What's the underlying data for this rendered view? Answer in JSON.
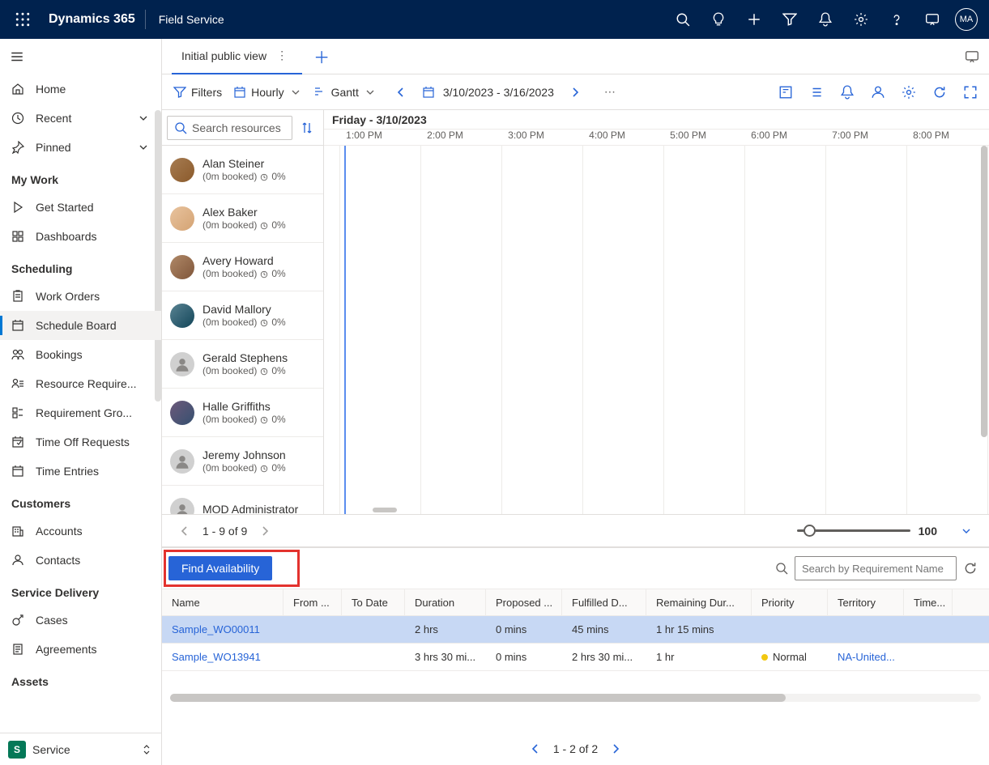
{
  "topbar": {
    "brand": "Dynamics 365",
    "app": "Field Service",
    "avatar": "MA"
  },
  "sidebar": {
    "items": {
      "home": "Home",
      "recent": "Recent",
      "pinned": "Pinned"
    },
    "groups": {
      "mywork": "My Work",
      "scheduling": "Scheduling",
      "customers": "Customers",
      "service_delivery": "Service Delivery",
      "assets": "Assets"
    },
    "mywork": {
      "get_started": "Get Started",
      "dashboards": "Dashboards"
    },
    "scheduling": {
      "work_orders": "Work Orders",
      "schedule_board": "Schedule Board",
      "bookings": "Bookings",
      "resource_req": "Resource Require...",
      "req_groups": "Requirement Gro...",
      "time_off": "Time Off Requests",
      "time_entries": "Time Entries"
    },
    "customers": {
      "accounts": "Accounts",
      "contacts": "Contacts"
    },
    "service_delivery": {
      "cases": "Cases",
      "agreements": "Agreements"
    },
    "area": "Service"
  },
  "tabs": {
    "active": "Initial public view"
  },
  "toolbar": {
    "filters": "Filters",
    "hourly": "Hourly",
    "gantt": "Gantt",
    "daterange": "3/10/2023 - 3/16/2023"
  },
  "search_resources_placeholder": "Search resources",
  "day_header": "Friday - 3/10/2023",
  "hours": [
    "1:00 PM",
    "2:00 PM",
    "3:00 PM",
    "4:00 PM",
    "5:00 PM",
    "6:00 PM",
    "7:00 PM",
    "8:00 PM"
  ],
  "resources": [
    {
      "name": "Alan Steiner",
      "meta": "(0m booked)",
      "pct": "0%",
      "photo": "photo1"
    },
    {
      "name": "Alex Baker",
      "meta": "(0m booked)",
      "pct": "0%",
      "photo": "photo2"
    },
    {
      "name": "Avery Howard",
      "meta": "(0m booked)",
      "pct": "0%",
      "photo": "photo3"
    },
    {
      "name": "David Mallory",
      "meta": "(0m booked)",
      "pct": "0%",
      "photo": "photo4"
    },
    {
      "name": "Gerald Stephens",
      "meta": "(0m booked)",
      "pct": "0%",
      "photo": "placeholder"
    },
    {
      "name": "Halle Griffiths",
      "meta": "(0m booked)",
      "pct": "0%",
      "photo": "photo6"
    },
    {
      "name": "Jeremy Johnson",
      "meta": "(0m booked)",
      "pct": "0%",
      "photo": "placeholder"
    },
    {
      "name": "MOD Administrator",
      "meta": "",
      "pct": "",
      "photo": "placeholder"
    }
  ],
  "pager": {
    "label": "1 - 9 of 9",
    "zoom": "100"
  },
  "req": {
    "find": "Find Availability",
    "search_placeholder": "Search by Requirement Name",
    "columns": {
      "name": "Name",
      "from": "From ...",
      "to": "To Date",
      "duration": "Duration",
      "proposed": "Proposed ...",
      "fulfilled": "Fulfilled D...",
      "remaining": "Remaining Dur...",
      "priority": "Priority",
      "territory": "Territory",
      "time": "Time..."
    },
    "rows": [
      {
        "name": "Sample_WO00011",
        "duration": "2 hrs",
        "proposed": "0 mins",
        "fulfilled": "45 mins",
        "remaining": "1 hr 15 mins",
        "priority": "",
        "territory": ""
      },
      {
        "name": "Sample_WO13941",
        "duration": "3 hrs 30 mi...",
        "proposed": "0 mins",
        "fulfilled": "2 hrs 30 mi...",
        "remaining": "1 hr",
        "priority": "Normal",
        "territory": "NA-United..."
      }
    ],
    "footer": "1 - 2 of 2"
  }
}
